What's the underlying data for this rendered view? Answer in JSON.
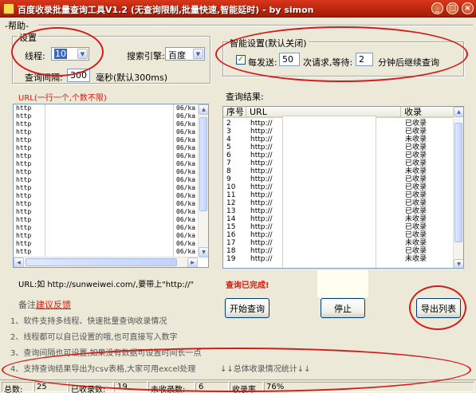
{
  "window": {
    "title": "百度收录批量查询工具V1.2 (无查询限制,批量快速,智能延时)  - by simon",
    "controls": {
      "minimize": "_",
      "maximize": "□",
      "close": "×"
    }
  },
  "menu": {
    "help": "-帮助-"
  },
  "settings": {
    "legend": "设置",
    "threads_label": "线程:",
    "threads_value": "10",
    "engine_label": "搜索引擎:",
    "engine_value": "百度",
    "interval_label": "查询间隔:",
    "interval_value": "300",
    "interval_unit": "毫秒(默认300ms)"
  },
  "smart": {
    "legend": "智能设置(默认关闭)",
    "checkbox_label": "每发送:",
    "send_count": "50",
    "mid_text": "次请求,等待:",
    "wait_minutes": "2",
    "end_text": "分钟后继续查询"
  },
  "url_section": {
    "label": "URL(一行一个,个数不限)",
    "line_prefix": "http",
    "line_suffix": "06/ka",
    "example": "URL:如 http://sunweiwei.com/,要带上\"http://\""
  },
  "results": {
    "label": "查询结果:",
    "columns": [
      "序号",
      "URL",
      "收录"
    ],
    "url_prefix": "http://",
    "rows": [
      {
        "no": "2",
        "status": "已收录"
      },
      {
        "no": "3",
        "status": "已收录"
      },
      {
        "no": "4",
        "status": "未收录"
      },
      {
        "no": "5",
        "status": "已收录"
      },
      {
        "no": "6",
        "status": "已收录"
      },
      {
        "no": "7",
        "status": "已收录"
      },
      {
        "no": "8",
        "status": "未收录"
      },
      {
        "no": "9",
        "status": "已收录"
      },
      {
        "no": "10",
        "status": "已收录"
      },
      {
        "no": "11",
        "status": "已收录"
      },
      {
        "no": "12",
        "status": "已收录"
      },
      {
        "no": "13",
        "status": "已收录"
      },
      {
        "no": "14",
        "status": "未收录"
      },
      {
        "no": "15",
        "status": "已收录"
      },
      {
        "no": "16",
        "status": "已收录"
      },
      {
        "no": "17",
        "status": "未收录"
      },
      {
        "no": "18",
        "status": "已收录"
      },
      {
        "no": "19",
        "status": "未收录"
      }
    ],
    "done_text": "查询已完成!"
  },
  "notes": {
    "title": "备注:",
    "feedback_link": "建议反馈",
    "items": [
      "1、软件支持多线程、快速批量查询收录情况",
      "2、线程都可以自已设置的哦,也可直接写入数字",
      "3、查询间隔也可设置,如果没有数据可设置时间长一点",
      "4、支持查询结果导出为csv表格,大家可用excel处理"
    ],
    "summary_link": "↓↓总体收录情况统计↓↓"
  },
  "buttons": {
    "start": "开始查询",
    "stop": "停止",
    "export": "导出列表"
  },
  "status": {
    "total_label": "总数:",
    "total_value": "25",
    "indexed_label": "已收录数:",
    "indexed_value": "19",
    "unindexed_label": "未收录数:",
    "unindexed_value": "6",
    "rate_label": "收录率",
    "rate_value": "76%"
  }
}
